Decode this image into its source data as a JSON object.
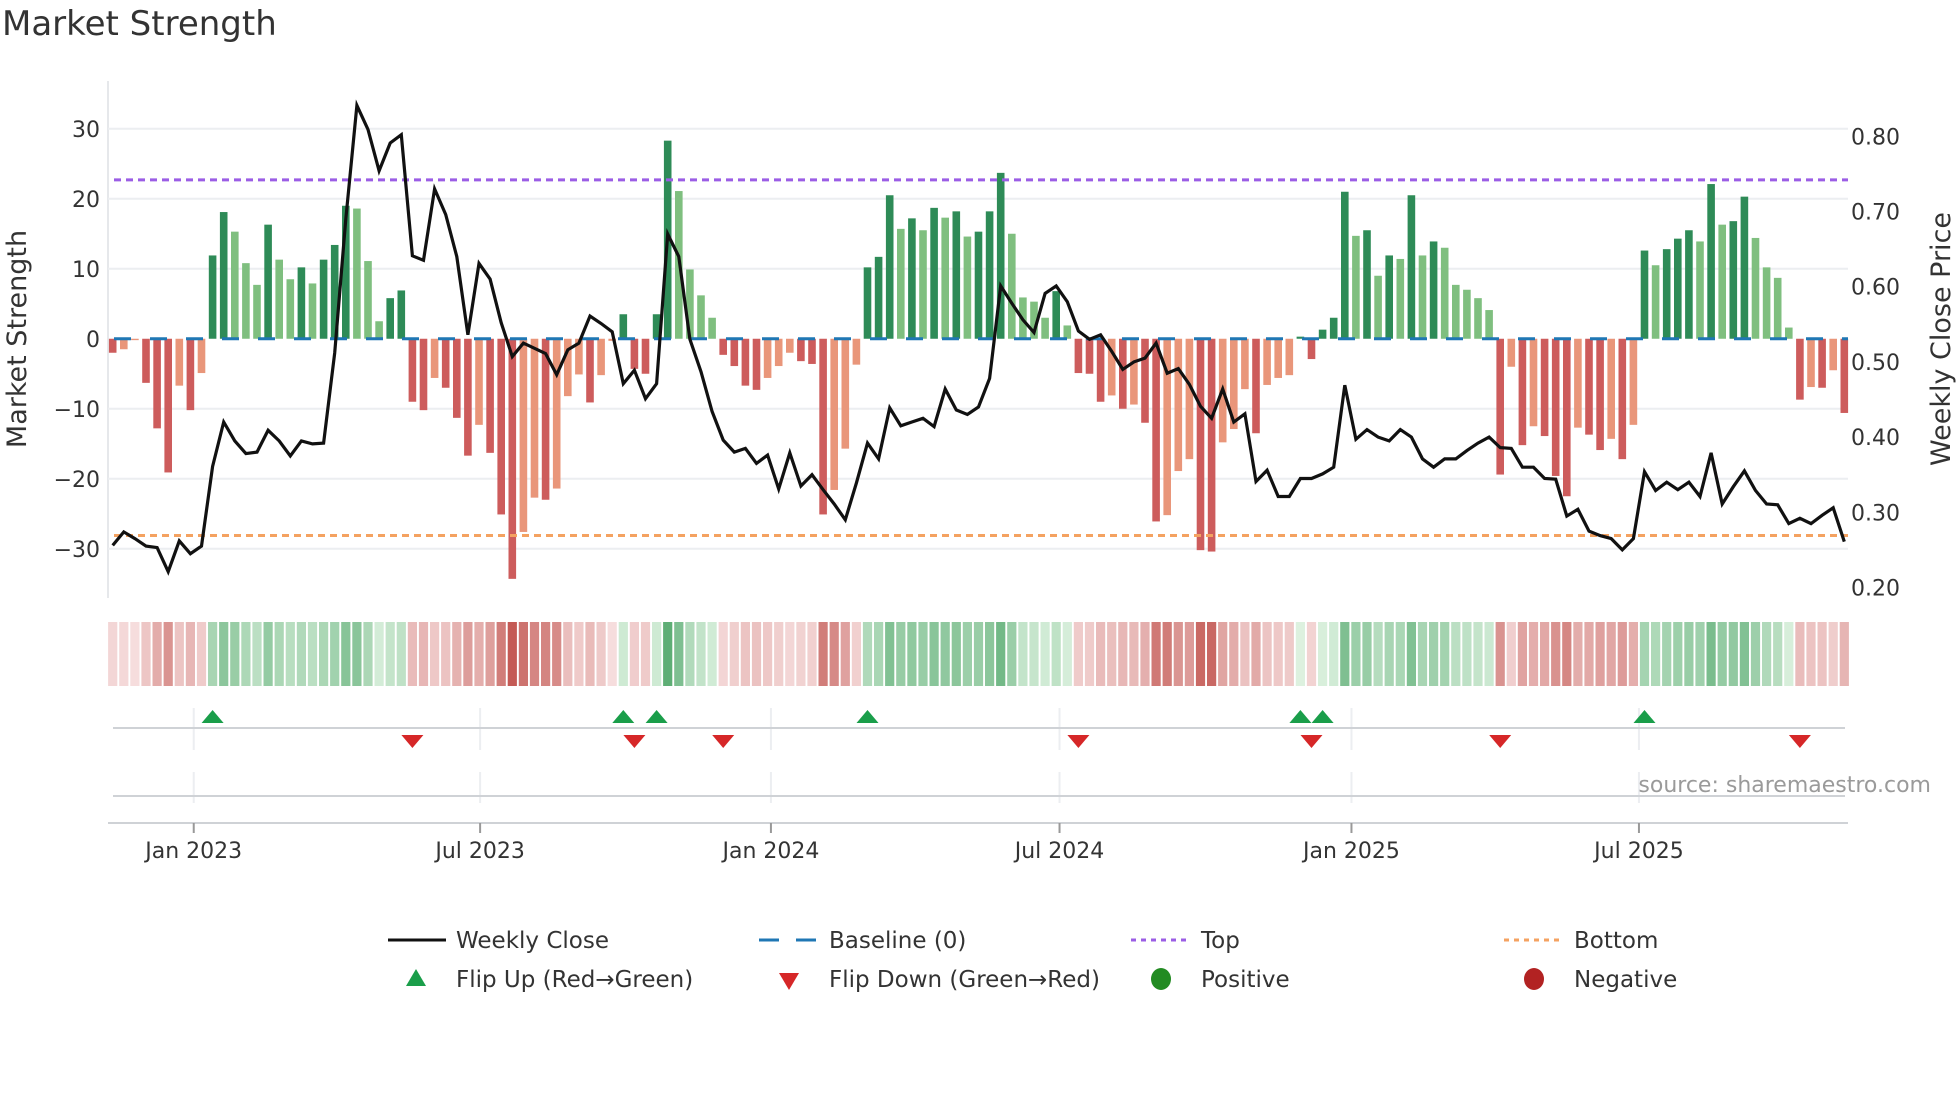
{
  "title": "Market Strength",
  "source": "source: sharemaestro.com",
  "chart_data": {
    "type": "bar+line",
    "title": "Market Strength",
    "x_unit": "week index",
    "x_ticks": [
      {
        "label": "Jan 2023",
        "week": 7.3
      },
      {
        "label": "Jul 2023",
        "week": 33.1
      },
      {
        "label": "Jan 2024",
        "week": 59.3
      },
      {
        "label": "Jul 2024",
        "week": 85.3
      },
      {
        "label": "Jan 2025",
        "week": 111.6
      },
      {
        "label": "Jul 2025",
        "week": 137.5
      }
    ],
    "y_left": {
      "label": "Market Strength",
      "range": [
        -37,
        36.8
      ],
      "ticks": [
        "30",
        "20",
        "10",
        "0",
        "−10",
        "−20",
        "−30"
      ],
      "tick_values": [
        30,
        20,
        10,
        0,
        -10,
        -20,
        -30
      ]
    },
    "y_right": {
      "label": "Weekly Close Price",
      "range": [
        0.187,
        0.873
      ],
      "ticks": [
        "0.80",
        "0.70",
        "0.60",
        "0.50",
        "0.40",
        "0.30",
        "0.20"
      ],
      "tick_values": [
        0.8,
        0.7,
        0.6,
        0.5,
        0.4,
        0.3,
        0.2
      ]
    },
    "baseline": 0,
    "top_level": 22.7,
    "bottom_level": -28.1,
    "strength": [
      -2.0,
      -1.5,
      -0.2,
      -6.3,
      -12.8,
      -19.1,
      -6.7,
      -10.2,
      -4.9,
      11.9,
      18.1,
      15.3,
      10.8,
      7.7,
      16.3,
      11.3,
      8.5,
      10.2,
      7.9,
      11.3,
      13.4,
      19.0,
      18.6,
      11.1,
      2.5,
      5.8,
      6.9,
      -9.0,
      -10.2,
      -5.6,
      -7.0,
      -11.3,
      -16.7,
      -12.3,
      -16.3,
      -25.1,
      -34.3,
      -27.6,
      -22.7,
      -23.0,
      -21.4,
      -8.2,
      -5.1,
      -9.1,
      -5.2,
      -0.3,
      3.5,
      -4.3,
      -5.0,
      3.5,
      28.3,
      21.1,
      9.9,
      6.2,
      3.0,
      -2.3,
      -3.9,
      -6.7,
      -7.3,
      -5.6,
      -3.9,
      -2.0,
      -3.2,
      -3.6,
      -25.1,
      -21.6,
      -15.7,
      -3.7,
      10.2,
      11.7,
      20.5,
      15.7,
      17.2,
      15.5,
      18.7,
      17.3,
      18.2,
      14.6,
      15.3,
      18.2,
      23.7,
      15.0,
      5.9,
      5.3,
      3.0,
      6.8,
      1.9,
      -4.9,
      -5.0,
      -9.0,
      -8.1,
      -10.0,
      -9.4,
      -12.0,
      -26.1,
      -25.2,
      -18.9,
      -17.2,
      -30.2,
      -30.4,
      -14.8,
      -12.9,
      -7.2,
      -13.5,
      -6.6,
      -5.6,
      -5.2,
      0.3,
      -2.9,
      1.3,
      3.0,
      21.0,
      14.7,
      15.5,
      9.0,
      11.9,
      11.4,
      20.5,
      11.9,
      13.9,
      13.0,
      7.7,
      7.0,
      5.8,
      4.1,
      -19.4,
      -4.0,
      -15.2,
      -12.5,
      -13.9,
      -19.6,
      -22.5,
      -12.7,
      -13.7,
      -15.9,
      -14.3,
      -17.2,
      -12.3,
      12.6,
      10.5,
      12.8,
      14.3,
      15.5,
      13.9,
      22.1,
      16.3,
      16.8,
      20.3,
      14.4,
      10.2,
      8.7,
      1.6,
      -8.7,
      -6.9,
      -7.0,
      -4.5,
      -10.6
    ],
    "weekly_close": [
      0.256,
      0.274,
      0.265,
      0.255,
      0.253,
      0.221,
      0.262,
      0.245,
      0.255,
      0.361,
      0.42,
      0.395,
      0.378,
      0.38,
      0.409,
      0.395,
      0.375,
      0.395,
      0.391,
      0.392,
      0.512,
      0.69,
      0.841,
      0.809,
      0.754,
      0.791,
      0.802,
      0.641,
      0.635,
      0.73,
      0.696,
      0.64,
      0.536,
      0.631,
      0.61,
      0.552,
      0.507,
      0.525,
      0.518,
      0.511,
      0.483,
      0.516,
      0.525,
      0.561,
      0.551,
      0.54,
      0.471,
      0.489,
      0.451,
      0.471,
      0.67,
      0.64,
      0.53,
      0.487,
      0.434,
      0.396,
      0.38,
      0.385,
      0.365,
      0.376,
      0.331,
      0.379,
      0.335,
      0.35,
      0.33,
      0.311,
      0.29,
      0.339,
      0.392,
      0.371,
      0.439,
      0.415,
      0.42,
      0.425,
      0.414,
      0.464,
      0.436,
      0.43,
      0.44,
      0.478,
      0.601,
      0.578,
      0.556,
      0.539,
      0.591,
      0.601,
      0.58,
      0.541,
      0.53,
      0.536,
      0.514,
      0.49,
      0.5,
      0.505,
      0.525,
      0.485,
      0.491,
      0.47,
      0.441,
      0.425,
      0.464,
      0.42,
      0.431,
      0.341,
      0.356,
      0.321,
      0.321,
      0.345,
      0.345,
      0.351,
      0.36,
      0.469,
      0.397,
      0.41,
      0.4,
      0.395,
      0.41,
      0.4,
      0.371,
      0.36,
      0.371,
      0.371,
      0.382,
      0.392,
      0.4,
      0.386,
      0.385,
      0.36,
      0.36,
      0.345,
      0.344,
      0.295,
      0.304,
      0.275,
      0.269,
      0.265,
      0.25,
      0.265,
      0.354,
      0.329,
      0.34,
      0.33,
      0.34,
      0.321,
      0.379,
      0.311,
      0.334,
      0.355,
      0.329,
      0.311,
      0.31,
      0.285,
      0.292,
      0.285,
      0.296,
      0.306,
      0.261
    ],
    "flip_up_weeks": [
      9,
      46,
      49,
      68,
      107,
      109,
      138
    ],
    "flip_down_weeks": [
      27,
      47,
      55,
      87,
      108,
      125,
      152
    ],
    "colors": {
      "strong_green": "#2e8b57",
      "weak_green": "#7fbf7f",
      "strong_red": "#cd5c5c",
      "weak_red": "#e9967a",
      "line": "#111111",
      "baseline": "#1f77b4",
      "top": "#9b5de5",
      "bottom": "#f4a261",
      "flip_up": "#1a9e4a",
      "flip_down": "#d62728",
      "positive": "#228b22",
      "negative": "#b22222"
    },
    "legend": {
      "placement": "bottom-center",
      "items": [
        {
          "label": "Weekly Close",
          "symbol": "line"
        },
        {
          "label": "Baseline (0)",
          "symbol": "dash"
        },
        {
          "label": "Top",
          "symbol": "dot"
        },
        {
          "label": "Bottom",
          "symbol": "dot"
        },
        {
          "label": "Flip Up (Red→Green)",
          "symbol": "triangle-up"
        },
        {
          "label": "Flip Down (Green→Red)",
          "symbol": "triangle-down"
        },
        {
          "label": "Positive",
          "symbol": "circle"
        },
        {
          "label": "Negative",
          "symbol": "circle"
        }
      ]
    }
  }
}
